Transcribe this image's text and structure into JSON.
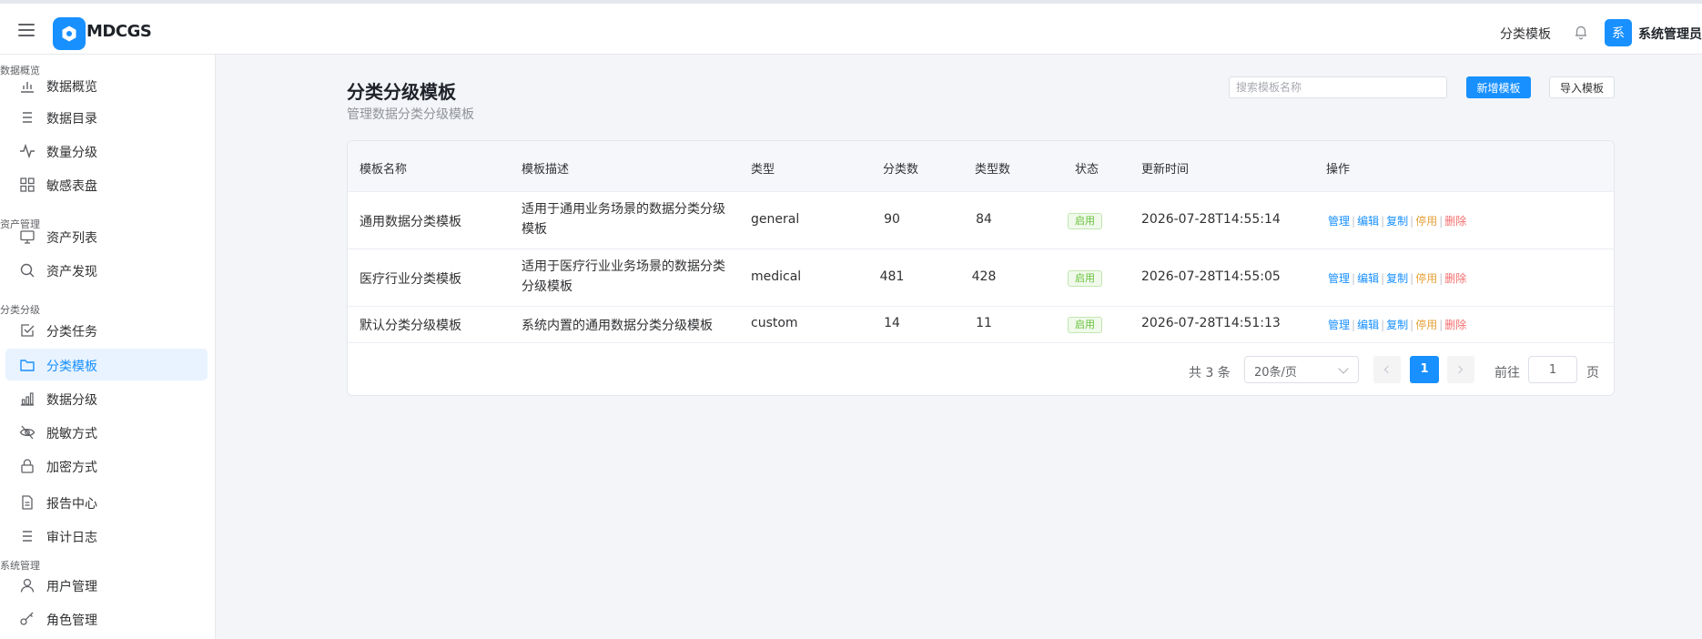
{
  "topbar": {
    "brand": "MDCGS",
    "right_link": "分类模板",
    "avatar_letter": "系",
    "username": "系统管理员"
  },
  "sidebar": {
    "groups": [
      {
        "title": "数据概览",
        "items": [
          "数据概览",
          "数据目录",
          "数量分级",
          "敏感表盘"
        ]
      },
      {
        "title": "资产管理",
        "items": [
          "资产列表",
          "资产发现"
        ]
      },
      {
        "title": "分类分级",
        "items": [
          "分类任务",
          "分类模板",
          "数据分级",
          "脱敏方式",
          "加密方式",
          "报告中心",
          "审计日志"
        ]
      },
      {
        "title": "系统管理",
        "items": [
          "用户管理",
          "角色管理"
        ]
      }
    ],
    "active_item": "分类模板"
  },
  "page": {
    "title": "分类分级模板",
    "subtitle": "管理数据分类分级模板",
    "search_placeholder": "搜索模板名称",
    "add_button": "新增模板",
    "import_button": "导入模板"
  },
  "table": {
    "columns": [
      "模板名称",
      "模板描述",
      "类型",
      "分类数",
      "类型数",
      "状态",
      "更新时间",
      "操作"
    ],
    "rows": [
      {
        "name": "通用数据分类模板",
        "desc": "适用于通用业务场景的数据分类分级模板",
        "type": "general",
        "categories": "90",
        "types": "84",
        "status": "启用",
        "updated": "2026-07-28T14:55:14"
      },
      {
        "name": "医疗行业分类模板",
        "desc": "适用于医疗行业业务场景的数据分类分级模板",
        "type": "medical",
        "categories": "481",
        "types": "428",
        "status": "启用",
        "updated": "2026-07-28T14:55:05"
      },
      {
        "name": "默认分类分级模板",
        "desc": "系统内置的通用数据分类分级模板",
        "type": "custom",
        "categories": "14",
        "types": "11",
        "status": "启用",
        "updated": "2026-07-28T14:51:13"
      }
    ],
    "actions": [
      "管理",
      "编辑",
      "复制",
      "停用",
      "删除"
    ]
  },
  "pagination": {
    "total": "共 3 条",
    "page_size": "20条/页",
    "current_page": "1",
    "goto_label": "前往",
    "goto_value": "1",
    "goto_unit": "页"
  },
  "colors": {
    "primary": "#1890ff",
    "success": "#67c23a",
    "warning": "#e6a23c",
    "danger": "#f56c6c"
  }
}
